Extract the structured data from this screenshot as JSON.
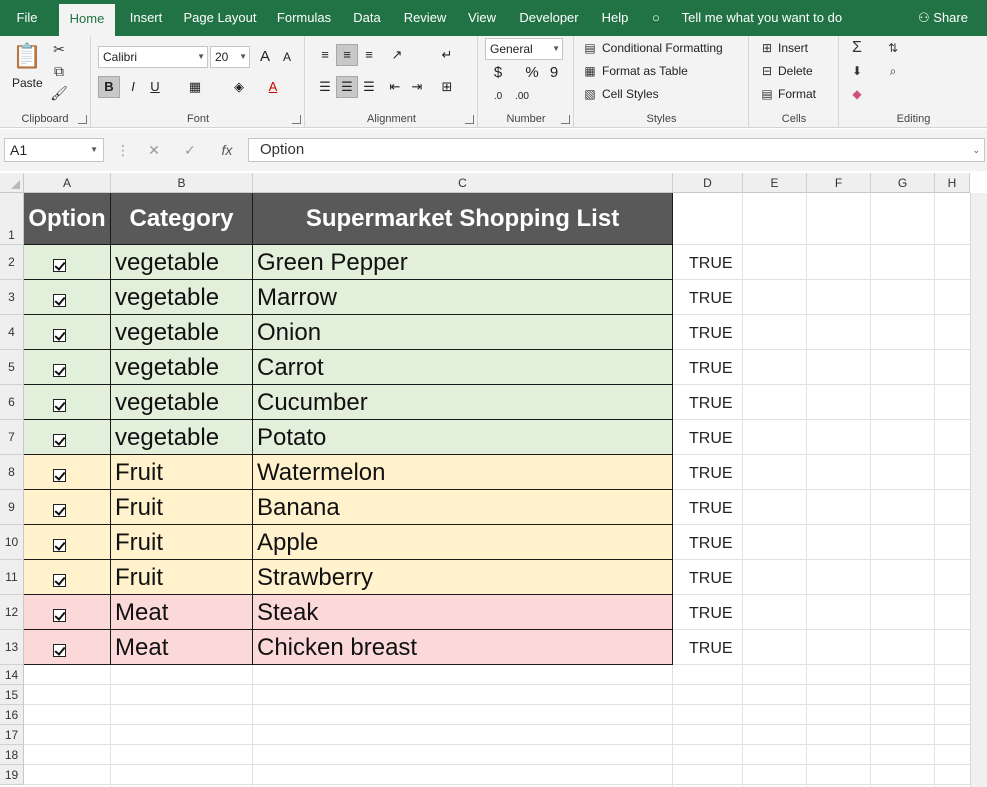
{
  "tabs": [
    "File",
    "Home",
    "Insert",
    "Page Layout",
    "Formulas",
    "Data",
    "Review",
    "View",
    "Developer",
    "Help"
  ],
  "active_tab": "Home",
  "tell_me": "Tell me what you want to do",
  "share": "Share",
  "ribbon": {
    "clipboard": {
      "label": "Clipboard",
      "paste": "Paste"
    },
    "font": {
      "label": "Font",
      "name": "Calibri",
      "size": "20",
      "bold": "B",
      "italic": "I",
      "underline": "U",
      "grow": "A",
      "shrink": "A"
    },
    "alignment": {
      "label": "Alignment"
    },
    "number": {
      "label": "Number",
      "format": "General",
      "currency": "$",
      "percent": "%",
      "comma": "9"
    },
    "styles": {
      "label": "Styles",
      "conditional": "Conditional Formatting",
      "format_table": "Format as Table",
      "cell_styles": "Cell Styles"
    },
    "cells": {
      "label": "Cells",
      "insert": "Insert",
      "delete": "Delete",
      "format": "Format"
    },
    "editing": {
      "label": "Editing"
    }
  },
  "formula_bar": {
    "name_box": "A1",
    "fx": "fx",
    "cancel": "✕",
    "enter": "✓",
    "value": "Option"
  },
  "columns": [
    "A",
    "B",
    "C",
    "D",
    "E",
    "F",
    "G",
    "H"
  ],
  "header_row": {
    "option": "Option",
    "category": "Category",
    "list": "Supermarket Shopping List"
  },
  "rows": [
    {
      "category": "vegetable",
      "item": "Green Pepper",
      "checked": true,
      "d": "TRUE"
    },
    {
      "category": "vegetable",
      "item": "Marrow",
      "checked": true,
      "d": "TRUE"
    },
    {
      "category": "vegetable",
      "item": "Onion",
      "checked": true,
      "d": "TRUE"
    },
    {
      "category": "vegetable",
      "item": "Carrot",
      "checked": true,
      "d": "TRUE"
    },
    {
      "category": "vegetable",
      "item": "Cucumber",
      "checked": true,
      "d": "TRUE"
    },
    {
      "category": "vegetable",
      "item": "Potato",
      "checked": true,
      "d": "TRUE"
    },
    {
      "category": "Fruit",
      "item": "Watermelon",
      "checked": true,
      "d": "TRUE"
    },
    {
      "category": "Fruit",
      "item": "Banana",
      "checked": true,
      "d": "TRUE"
    },
    {
      "category": "Fruit",
      "item": "Apple",
      "checked": true,
      "d": "TRUE"
    },
    {
      "category": "Fruit",
      "item": "Strawberry",
      "checked": true,
      "d": "TRUE"
    },
    {
      "category": "Meat",
      "item": "Steak",
      "checked": true,
      "d": "TRUE"
    },
    {
      "category": "Meat",
      "item": "Chicken breast",
      "checked": true,
      "d": "TRUE"
    }
  ],
  "row_numbers": [
    "1",
    "2",
    "3",
    "4",
    "5",
    "6",
    "7",
    "8",
    "9",
    "10",
    "11",
    "12",
    "13",
    "14",
    "15",
    "16",
    "17",
    "18",
    "19"
  ],
  "colors": {
    "vegetable": "#e2efda",
    "Fruit": "#fff2cc",
    "Meat": "#fcd9d9",
    "header": "#595959",
    "ribbon_green": "#217346"
  }
}
